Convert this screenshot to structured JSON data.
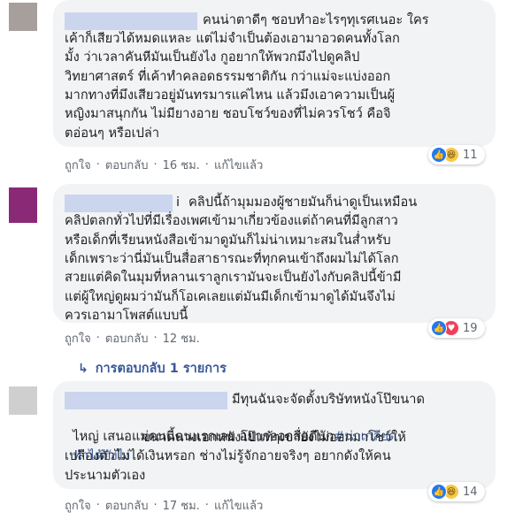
{
  "comments": [
    {
      "lines": [
        "คนน่าตาดีๆ ชอบทำอะไรๆทุเรศเนอะ ใคร",
        "เค้าก็เสียวได้หมดแหละ แต่ไม่จำเป็นต้องเอามาอวดคนทั้งโลก",
        "มั้ง ว่าเวลาคันหีมันเป็นยังไง กูอยากให้พวกมึงไปดูคลิป",
        "วิทยาศาสตร์ ที่เค้าทำคลอดธรรมชาติกัน กว่าแม่จะแบ่งออก",
        "มากทางที่มึงเสียวอยู่มันทรมารแค่ไหน แล้วมึงเอาความเป็นผู้",
        "หญิงมาสนุกกัน ไม่มียางอาย ชอบโชว์ของที่ไม่ควรโชว์ คือจิ",
        "ตอ่อนๆ หรือเปล่า"
      ],
      "like_label": "ถูกใจ",
      "reply_label": "ตอบกลับ",
      "time": "16 ชม.",
      "edited_label": "แก้ไขแล้ว",
      "reaction_count": "11",
      "reactions": [
        "like",
        "haha"
      ]
    },
    {
      "lines": [
        "คลิปนี้ถ้ามุมมองผู้ชายมันก็น่าดูเป็นเหมือน",
        "คลิปตลกทั่วไปที่มีเรื่องเพศเข้ามาเกี่ยวข้องแต่ถ้าคนที่มีลูกสาว",
        "หรือเด็กที่เรียนหนังสือเข้ามาดูมันก็ไม่น่าเหมาะสมในส่ำหรับ",
        "เด็กเพราะว่านี่มันเป็นสื่อสาธารณะที่ทุกคนเข้าถึงผมไม่ได้โลก",
        "สวยแต่คิดในมุมที่หลานเราลูกเรามันจะเป็นยังไงกับคลิปนี้ข้ามี",
        "แต่ผู้ใหญ่ดูผมว่ามันก็โอเคเลยแต่มันมีเด็กเข้ามาดูได้มันจึงไม่",
        "ควรเอามาโพสต์แบบนี้"
      ],
      "like_label": "ถูกใจ",
      "reply_label": "ตอบกลับ",
      "time": "12 ชม.",
      "reaction_count": "19",
      "reactions": [
        "like",
        "love"
      ]
    },
    {
      "lines": [
        "มีทุนฉันจะจัดตั้งบริษัทหนังโป๊ขนาด",
        "ไหญ่ เสนอแม่คนนี้คนแรกเลย อยากออกสื่อดีนัก",
        "ทำได้ยังไง ขนาดนางเอกหนังโป๊แท้ๆเขายังไม่ออกมาโชว์ให้",
        "เปลืองตัวไม่ได้เงินหรอก ช่างไม่รู้จักอายจริงๆ อยากดังให้คน",
        "ประนามตัวเอง"
      ],
      "hashtag_line1": "#น่าเกลียด",
      "hashtag_line2": "ทำได้ยังไง",
      "like_label": "ถูกใจ",
      "reply_label": "ตอบกลับ",
      "time": "17 ชม.",
      "edited_label": "แก้ไขแล้ว",
      "reaction_count": "14",
      "reactions": [
        "like",
        "haha"
      ]
    }
  ],
  "replies_toggle": {
    "label": "การตอบกลับ 1 รายการ",
    "icon": "reply-arrow-icon"
  },
  "second_name_suffix": "i",
  "colors": {
    "bubble": "#f2f3f5",
    "meta": "#606770",
    "link": "#385898",
    "redact": "#ccd5ee"
  }
}
